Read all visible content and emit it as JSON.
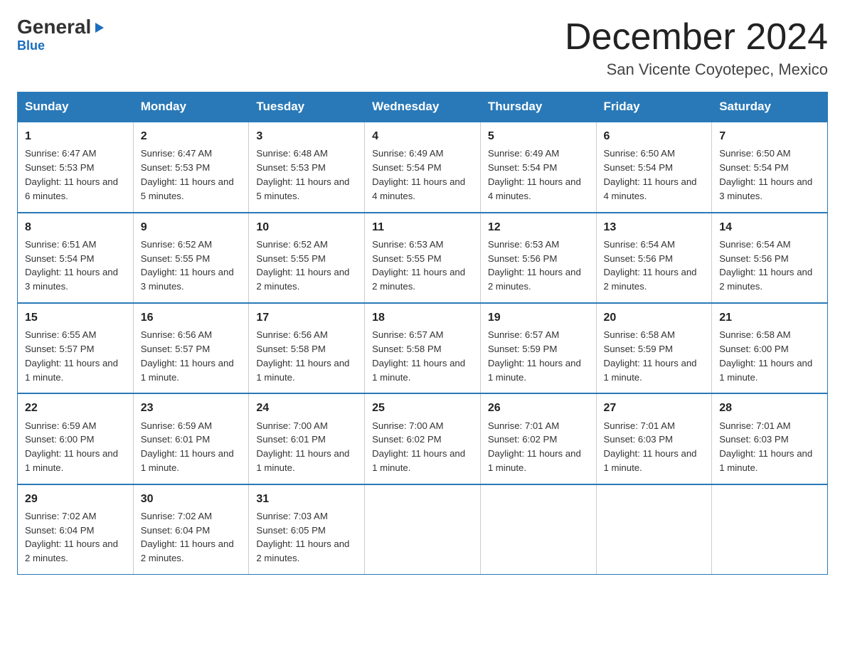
{
  "header": {
    "logo_general": "General",
    "logo_blue": "Blue",
    "month_title": "December 2024",
    "location": "San Vicente Coyotepec, Mexico"
  },
  "days_of_week": [
    "Sunday",
    "Monday",
    "Tuesday",
    "Wednesday",
    "Thursday",
    "Friday",
    "Saturday"
  ],
  "weeks": [
    [
      {
        "day": "1",
        "sunrise": "6:47 AM",
        "sunset": "5:53 PM",
        "daylight": "11 hours and 6 minutes."
      },
      {
        "day": "2",
        "sunrise": "6:47 AM",
        "sunset": "5:53 PM",
        "daylight": "11 hours and 5 minutes."
      },
      {
        "day": "3",
        "sunrise": "6:48 AM",
        "sunset": "5:53 PM",
        "daylight": "11 hours and 5 minutes."
      },
      {
        "day": "4",
        "sunrise": "6:49 AM",
        "sunset": "5:54 PM",
        "daylight": "11 hours and 4 minutes."
      },
      {
        "day": "5",
        "sunrise": "6:49 AM",
        "sunset": "5:54 PM",
        "daylight": "11 hours and 4 minutes."
      },
      {
        "day": "6",
        "sunrise": "6:50 AM",
        "sunset": "5:54 PM",
        "daylight": "11 hours and 4 minutes."
      },
      {
        "day": "7",
        "sunrise": "6:50 AM",
        "sunset": "5:54 PM",
        "daylight": "11 hours and 3 minutes."
      }
    ],
    [
      {
        "day": "8",
        "sunrise": "6:51 AM",
        "sunset": "5:54 PM",
        "daylight": "11 hours and 3 minutes."
      },
      {
        "day": "9",
        "sunrise": "6:52 AM",
        "sunset": "5:55 PM",
        "daylight": "11 hours and 3 minutes."
      },
      {
        "day": "10",
        "sunrise": "6:52 AM",
        "sunset": "5:55 PM",
        "daylight": "11 hours and 2 minutes."
      },
      {
        "day": "11",
        "sunrise": "6:53 AM",
        "sunset": "5:55 PM",
        "daylight": "11 hours and 2 minutes."
      },
      {
        "day": "12",
        "sunrise": "6:53 AM",
        "sunset": "5:56 PM",
        "daylight": "11 hours and 2 minutes."
      },
      {
        "day": "13",
        "sunrise": "6:54 AM",
        "sunset": "5:56 PM",
        "daylight": "11 hours and 2 minutes."
      },
      {
        "day": "14",
        "sunrise": "6:54 AM",
        "sunset": "5:56 PM",
        "daylight": "11 hours and 2 minutes."
      }
    ],
    [
      {
        "day": "15",
        "sunrise": "6:55 AM",
        "sunset": "5:57 PM",
        "daylight": "11 hours and 1 minute."
      },
      {
        "day": "16",
        "sunrise": "6:56 AM",
        "sunset": "5:57 PM",
        "daylight": "11 hours and 1 minute."
      },
      {
        "day": "17",
        "sunrise": "6:56 AM",
        "sunset": "5:58 PM",
        "daylight": "11 hours and 1 minute."
      },
      {
        "day": "18",
        "sunrise": "6:57 AM",
        "sunset": "5:58 PM",
        "daylight": "11 hours and 1 minute."
      },
      {
        "day": "19",
        "sunrise": "6:57 AM",
        "sunset": "5:59 PM",
        "daylight": "11 hours and 1 minute."
      },
      {
        "day": "20",
        "sunrise": "6:58 AM",
        "sunset": "5:59 PM",
        "daylight": "11 hours and 1 minute."
      },
      {
        "day": "21",
        "sunrise": "6:58 AM",
        "sunset": "6:00 PM",
        "daylight": "11 hours and 1 minute."
      }
    ],
    [
      {
        "day": "22",
        "sunrise": "6:59 AM",
        "sunset": "6:00 PM",
        "daylight": "11 hours and 1 minute."
      },
      {
        "day": "23",
        "sunrise": "6:59 AM",
        "sunset": "6:01 PM",
        "daylight": "11 hours and 1 minute."
      },
      {
        "day": "24",
        "sunrise": "7:00 AM",
        "sunset": "6:01 PM",
        "daylight": "11 hours and 1 minute."
      },
      {
        "day": "25",
        "sunrise": "7:00 AM",
        "sunset": "6:02 PM",
        "daylight": "11 hours and 1 minute."
      },
      {
        "day": "26",
        "sunrise": "7:01 AM",
        "sunset": "6:02 PM",
        "daylight": "11 hours and 1 minute."
      },
      {
        "day": "27",
        "sunrise": "7:01 AM",
        "sunset": "6:03 PM",
        "daylight": "11 hours and 1 minute."
      },
      {
        "day": "28",
        "sunrise": "7:01 AM",
        "sunset": "6:03 PM",
        "daylight": "11 hours and 1 minute."
      }
    ],
    [
      {
        "day": "29",
        "sunrise": "7:02 AM",
        "sunset": "6:04 PM",
        "daylight": "11 hours and 2 minutes."
      },
      {
        "day": "30",
        "sunrise": "7:02 AM",
        "sunset": "6:04 PM",
        "daylight": "11 hours and 2 minutes."
      },
      {
        "day": "31",
        "sunrise": "7:03 AM",
        "sunset": "6:05 PM",
        "daylight": "11 hours and 2 minutes."
      },
      {
        "day": "",
        "sunrise": "",
        "sunset": "",
        "daylight": ""
      },
      {
        "day": "",
        "sunrise": "",
        "sunset": "",
        "daylight": ""
      },
      {
        "day": "",
        "sunrise": "",
        "sunset": "",
        "daylight": ""
      },
      {
        "day": "",
        "sunrise": "",
        "sunset": "",
        "daylight": ""
      }
    ]
  ]
}
